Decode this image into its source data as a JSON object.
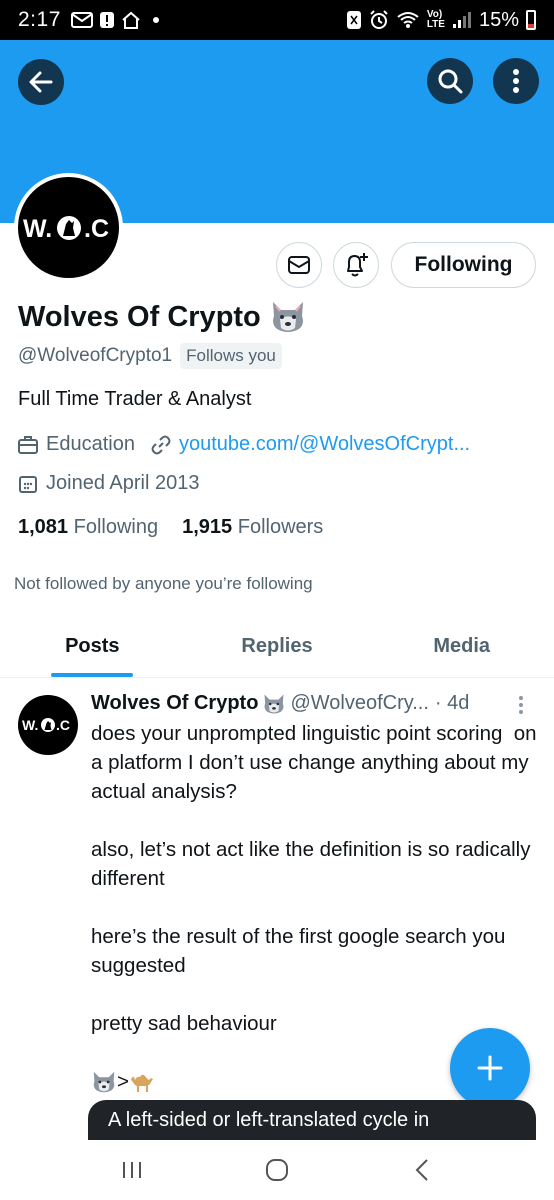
{
  "status_bar": {
    "time": "2:17",
    "battery": "15%",
    "icons": [
      "mail-icon",
      "alert-icon",
      "home-icon",
      "dot-icon",
      "nfc-icon",
      "alarm-icon",
      "wifi-calling-icon",
      "volte-icon",
      "signal-icon",
      "battery-icon"
    ],
    "network": "Vo) LTE"
  },
  "header": {
    "banner_color": "#1d9bf0",
    "back_icon": "arrow-left-icon",
    "search_icon": "search-icon",
    "more_icon": "more-vertical-icon"
  },
  "profile": {
    "avatar_text": "W.◉.C",
    "display_name": "Wolves Of Crypto",
    "name_emoji": "wolf-emoji",
    "handle": "@WolveofCrypto1",
    "follows_you": "Follows you",
    "bio": "Full Time Trader & Analyst",
    "category": "Education",
    "link": "youtube.com/@WolvesOfCrypt...",
    "joined": "Joined April 2013",
    "following_count": "1,081",
    "following_label": "Following",
    "followers_count": "1,915",
    "followers_label": "Followers",
    "not_followed": "Not followed by anyone you’re following"
  },
  "actions": {
    "following_button": "Following"
  },
  "tabs": [
    {
      "label": "Posts",
      "active": true
    },
    {
      "label": "Replies",
      "active": false
    },
    {
      "label": "Media",
      "active": false
    }
  ],
  "post": {
    "avatar_text": "W.◉.C",
    "name": "Wolves Of Crypto",
    "handle": "@WolveofCry...",
    "time": "· 4d",
    "body": "does your unprompted linguistic point scoring  on a platform I don’t use change anything about my actual analysis?\n\nalso, let’s not act like the definition is so radically different\n\nhere’s the result of the first google search you suggested\n\npretty sad behaviour\n\n",
    "emoji_line": ">"
  },
  "tooltip": {
    "text": "A left-sided or left-translated cycle in"
  },
  "accent_color": "#1d9bf0"
}
